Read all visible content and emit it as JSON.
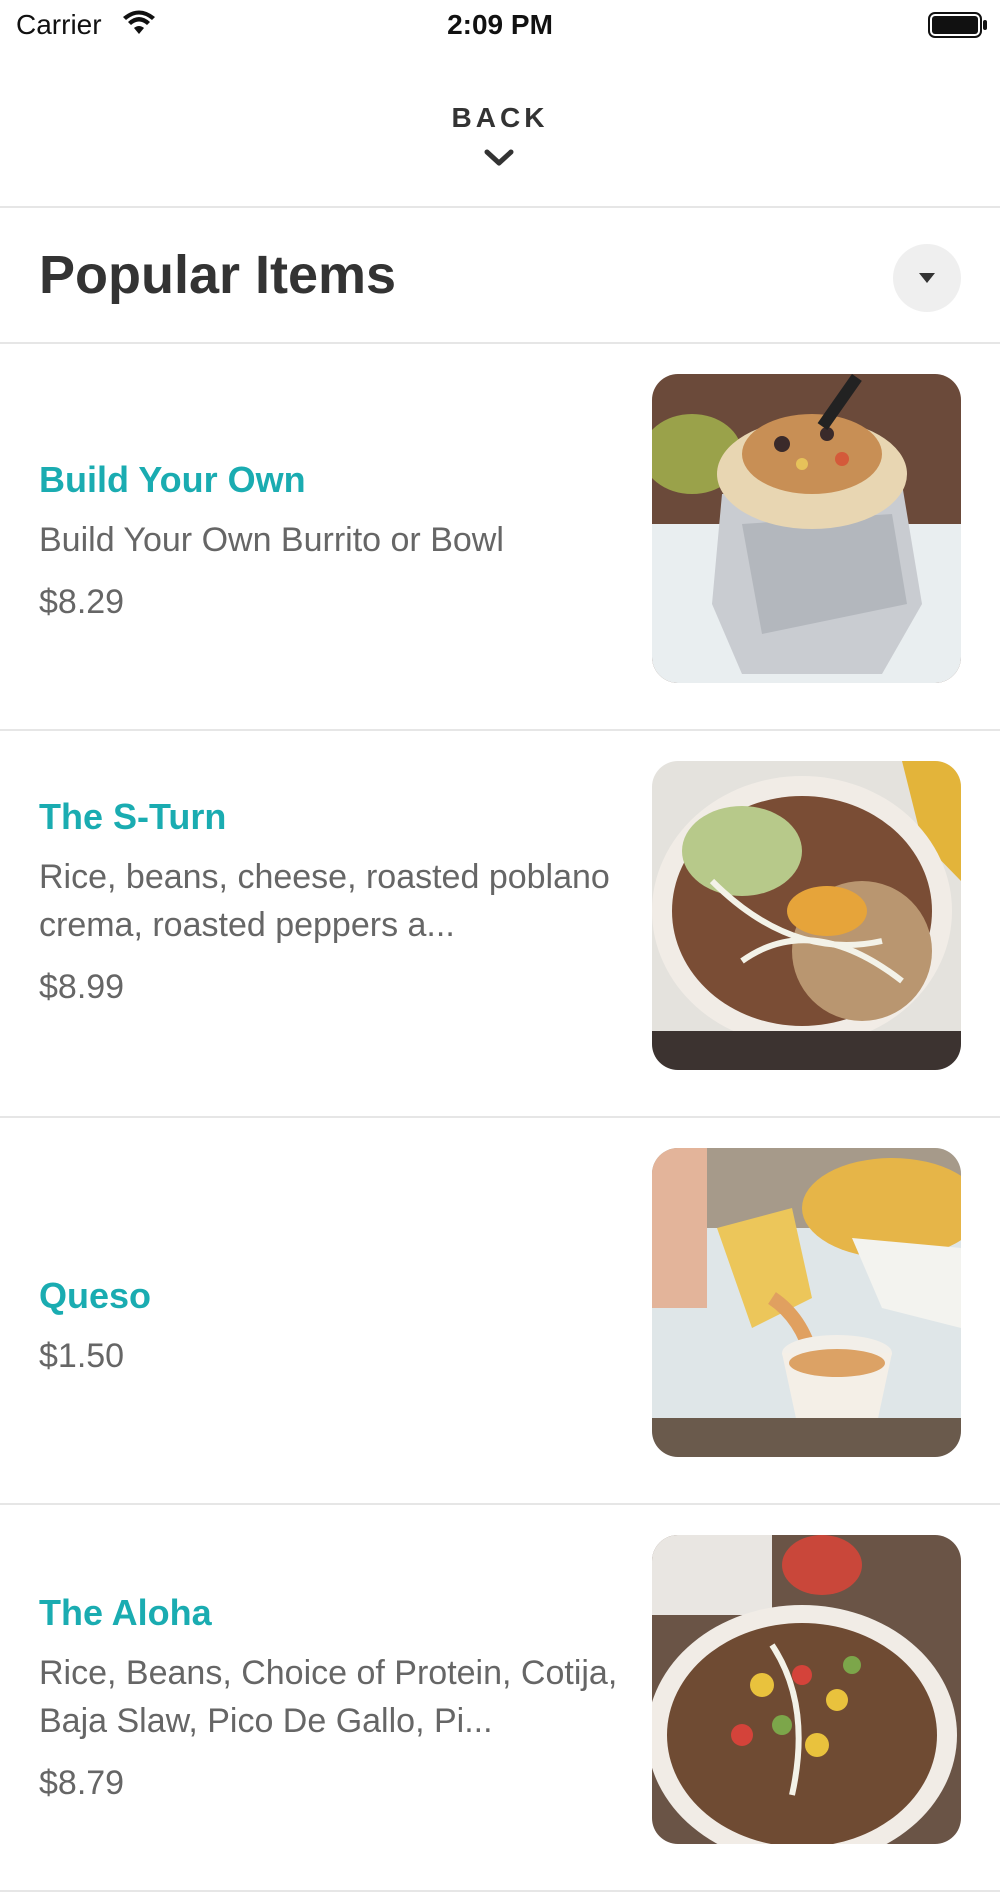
{
  "status_bar": {
    "carrier": "Carrier",
    "time": "2:09 PM"
  },
  "nav": {
    "back_label": "BACK"
  },
  "section": {
    "title": "Popular Items"
  },
  "items": [
    {
      "name": "Build Your Own",
      "description": "Build Your Own Burrito or Bowl",
      "price": "$8.29"
    },
    {
      "name": "The S-Turn",
      "description": "Rice, beans, cheese, roasted poblano crema, roasted peppers a...",
      "price": "$8.99"
    },
    {
      "name": "Queso",
      "description": "",
      "price": "$1.50"
    },
    {
      "name": "The Aloha",
      "description": "Rice, Beans, Choice of Protein, Cotija, Baja Slaw, Pico De Gallo, Pi...",
      "price": "$8.79"
    }
  ],
  "colors": {
    "accent": "#1aacb1",
    "text_primary": "#333333",
    "text_secondary": "#666666",
    "divider": "#e6e6e6"
  }
}
